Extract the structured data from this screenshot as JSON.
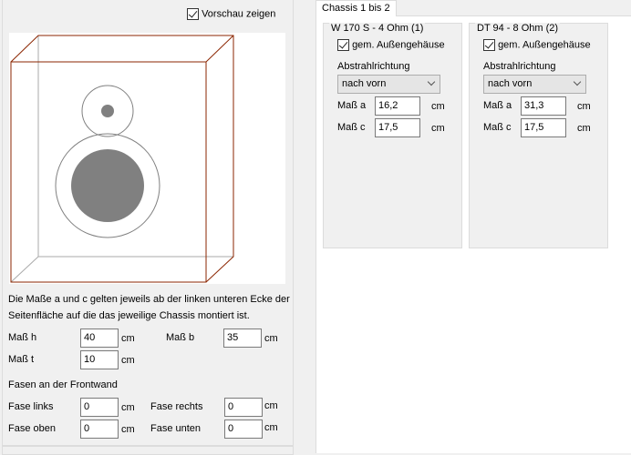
{
  "preview": {
    "show_label": "Vorschau zeigen",
    "checked": true
  },
  "info_text_line1": "Die Maße a und c gelten jeweils ab der linken unteren Ecke der",
  "info_text_line2": "Seitenfläche auf die das jeweilige Chassis montiert ist.",
  "unit": "cm",
  "dims": {
    "h": {
      "label": "Maß h",
      "value": "40"
    },
    "b": {
      "label": "Maß b",
      "value": "35"
    },
    "t": {
      "label": "Maß t",
      "value": "10"
    }
  },
  "bevels": {
    "title": "Fasen an der Frontwand",
    "links": {
      "label": "Fase links",
      "value": "0"
    },
    "rechts": {
      "label": "Fase rechts",
      "value": "0"
    },
    "oben": {
      "label": "Fase oben",
      "value": "0"
    },
    "unten": {
      "label": "Fase unten",
      "value": "0"
    }
  },
  "tab": {
    "label": "Chassis 1 bis 2"
  },
  "chassis": [
    {
      "title": "W 170 S - 4 Ohm (1)",
      "checkbox": "gem. Außengehäuse",
      "checked": true,
      "direction_label": "Abstrahlrichtung",
      "direction": "nach vorn",
      "a_label": "Maß a",
      "a": "16,2",
      "c_label": "Maß c",
      "c": "17,5",
      "unit": "cm"
    },
    {
      "title": "DT 94 - 8 Ohm (2)",
      "checkbox": "gem. Außengehäuse",
      "checked": true,
      "direction_label": "Abstrahlrichtung",
      "direction": "nach vorn",
      "a_label": "Maß a",
      "a": "31,3",
      "c_label": "Maß c",
      "c": "17,5",
      "unit": "cm"
    }
  ],
  "colors": {
    "box_edge": "#8b2500",
    "driver": "#808080"
  }
}
